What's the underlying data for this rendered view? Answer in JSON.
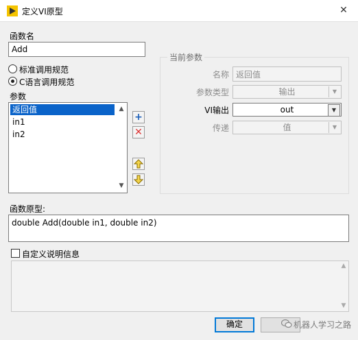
{
  "window": {
    "title": "定义VI原型",
    "close_glyph": "✕"
  },
  "function_name": {
    "label": "函数名",
    "value": "Add"
  },
  "calling_conventions": {
    "options": [
      {
        "label": "标准调用规范",
        "selected": false
      },
      {
        "label": "C语言调用规范",
        "selected": true
      }
    ]
  },
  "parameters": {
    "label": "参数",
    "items": [
      "返回值",
      "in1",
      "in2"
    ],
    "selected_index": 0
  },
  "current_param": {
    "group_label": "当前参数",
    "name_label": "名称",
    "name_value": "返回值",
    "type_label": "参数类型",
    "type_value": "输出",
    "vi_output_label": "VI输出",
    "vi_output_value": "out",
    "pass_label": "传递",
    "pass_value": "值"
  },
  "prototype": {
    "label": "函数原型:",
    "value": "double Add(double in1, double in2)"
  },
  "custom_description": {
    "label": "自定义说明信息",
    "checked": false
  },
  "buttons": {
    "ok": "确定"
  },
  "watermark": "机器人学习之路",
  "colors": {
    "selection": "#0a63c9",
    "add_icon": "#1c5fb8",
    "delete_icon": "#d33",
    "arrow_icon": "#c8a000",
    "title_icon": "#f5c400"
  }
}
